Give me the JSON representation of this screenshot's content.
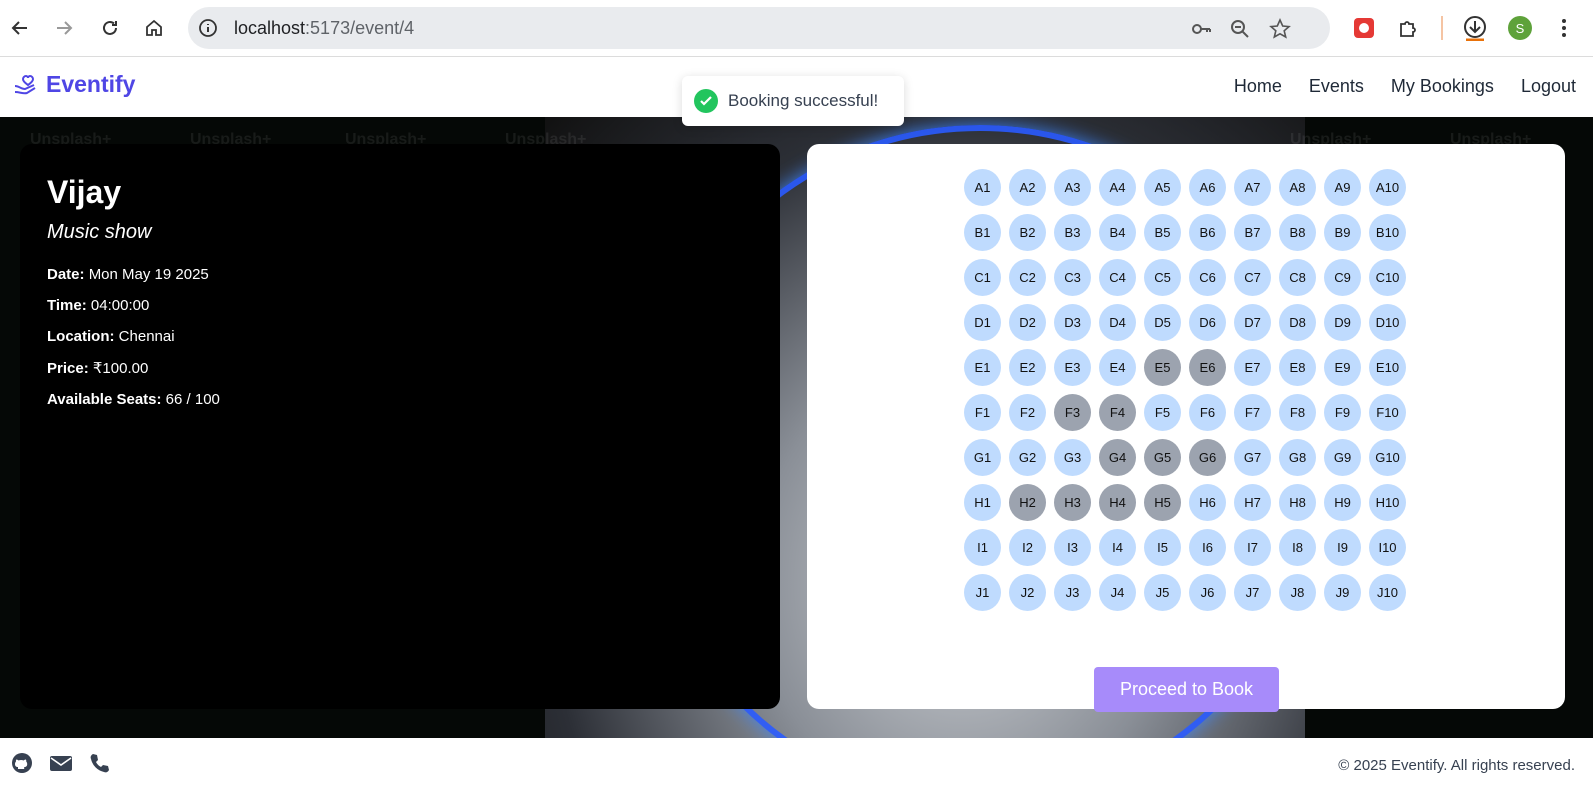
{
  "browser": {
    "url_host": "localhost",
    "url_path": ":5173/event/4",
    "profile_initial": "S"
  },
  "header": {
    "brand": "Eventify",
    "nav": [
      "Home",
      "Events",
      "My Bookings",
      "Logout"
    ]
  },
  "toast": {
    "message": "Booking successful!"
  },
  "event": {
    "title": "Vijay",
    "category": "Music show",
    "date_label": "Date:",
    "date": "Mon May 19 2025",
    "time_label": "Time:",
    "time": "04:00:00",
    "location_label": "Location:",
    "location": "Chennai",
    "price_label": "Price:",
    "price": "₹100.00",
    "seats_label": "Available Seats:",
    "seats": "66 / 100"
  },
  "seating": {
    "rows": [
      "A",
      "B",
      "C",
      "D",
      "E",
      "F",
      "G",
      "H",
      "I",
      "J"
    ],
    "cols": 10,
    "booked": [
      "E5",
      "E6",
      "F3",
      "F4",
      "G4",
      "G5",
      "G6",
      "H2",
      "H3",
      "H4",
      "H5"
    ],
    "button": "Proceed to Book"
  },
  "watermark": "Unsplash+",
  "footer": {
    "copyright": "© 2025 Eventify. All rights reserved."
  },
  "colors": {
    "brand": "#4f46e5",
    "seat_available": "#bfdbfe",
    "seat_booked": "#9ca3af",
    "book_button": "#a78bfa",
    "toast_check": "#22c55e"
  }
}
